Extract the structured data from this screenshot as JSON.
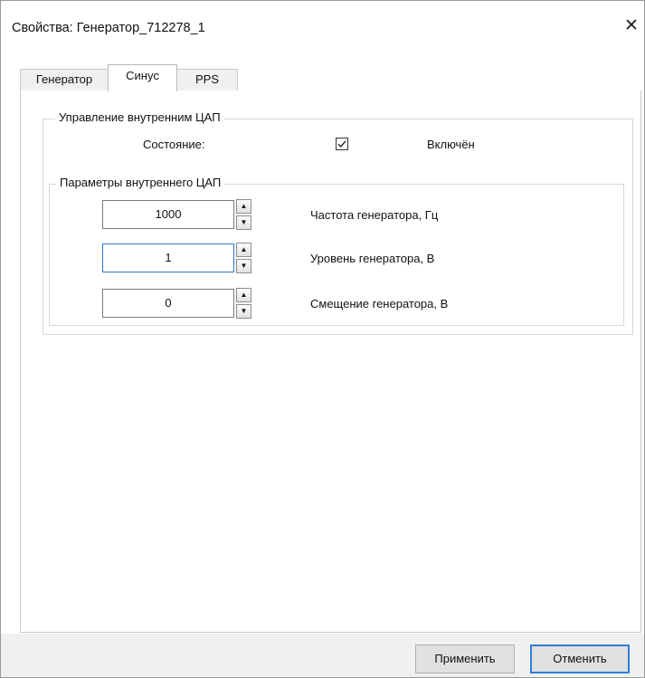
{
  "window": {
    "title": "Свойства: Генератор_712278_1",
    "close_glyph": "✕"
  },
  "tabs": [
    {
      "label": "Генератор"
    },
    {
      "label": "Синус"
    },
    {
      "label": "PPS"
    }
  ],
  "dac_control": {
    "group_title": "Управление внутренним ЦАП",
    "state_label": "Состояние:",
    "enabled_checked": true,
    "enabled_label": "Включён"
  },
  "dac_params": {
    "group_title": "Параметры внутреннего ЦАП",
    "rows": [
      {
        "value": "1000",
        "label": "Частота генератора, Гц"
      },
      {
        "value": "1",
        "label": "Уровень генератора, В"
      },
      {
        "value": "0",
        "label": "Смещение генератора, В"
      }
    ]
  },
  "buttons": {
    "apply": "Применить",
    "cancel": "Отменить"
  }
}
